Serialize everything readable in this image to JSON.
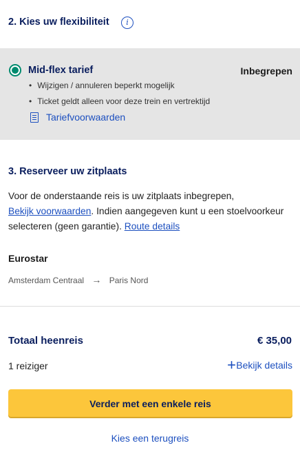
{
  "flex_section": {
    "title": "2. Kies uw flexibiliteit",
    "info_icon": "i"
  },
  "fare": {
    "name": "Mid-flex tarief",
    "status": "Inbegrepen",
    "features": [
      "Wijzigen / annuleren beperkt mogelijk",
      "Ticket geldt alleen voor deze trein en vertrektijd"
    ],
    "conditions_link": "Tariefvoorwaarden",
    "selected": true
  },
  "seat_section": {
    "title": "3. Reserveer uw zitplaats",
    "text_part1": "Voor de onderstaande reis is uw zitplaats inbegrepen,",
    "link_conditions": "Bekijk voorwaarden",
    "text_part2": ". Indien aangegeven kunt u een stoelvoorkeur selecteren (geen garantie).",
    "link_route": "Route details"
  },
  "journey": {
    "operator": "Eurostar",
    "from": "Amsterdam Centraal",
    "to": "Paris Nord"
  },
  "summary": {
    "total_label": "Totaal heenreis",
    "total_price": "€ 35,00",
    "travellers": "1 reiziger",
    "details_link": "Bekijk details"
  },
  "actions": {
    "primary": "Verder met een enkele reis",
    "secondary": "Kies een terugreis"
  },
  "colors": {
    "brand_blue": "#0a1e5e",
    "link_blue": "#1c4fbf",
    "accent_yellow": "#fcc63b",
    "radio_green": "#008a6e"
  }
}
